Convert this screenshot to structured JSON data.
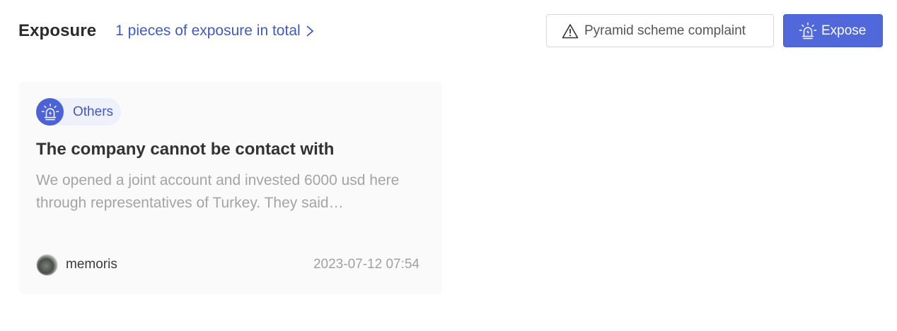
{
  "header": {
    "title": "Exposure",
    "total_link": "1 pieces of exposure in total",
    "complaint_button": "Pyramid scheme complaint",
    "expose_button": "Expose"
  },
  "icons": {
    "total_link": "chevron-right-icon",
    "complaint_button": "warning-triangle-icon",
    "expose_button": "alarm-siren-icon",
    "tag": "alarm-siren-icon"
  },
  "colors": {
    "accent": "#5068d9",
    "link": "#3d5ac7",
    "tag_bg": "#eef0fa"
  },
  "exposures": [
    {
      "tag": "Others",
      "title": "The company cannot be contact with",
      "description": "We opened a joint account and invested 6000 usd here through representatives of Turkey. They said…",
      "user": "memoris",
      "timestamp": "2023-07-12 07:54"
    }
  ]
}
